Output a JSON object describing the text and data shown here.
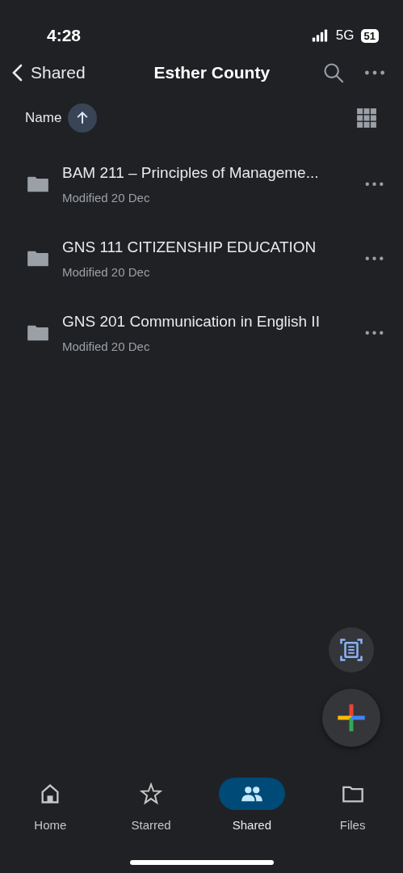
{
  "status_bar": {
    "time": "4:28",
    "network": "5G",
    "battery": "51"
  },
  "header": {
    "back_label": "Shared",
    "title": "Esther County"
  },
  "sort": {
    "label": "Name"
  },
  "files": [
    {
      "name": "BAM 211 – Principles of Manageme...",
      "modified": "Modified 20 Dec"
    },
    {
      "name": "GNS 111 CITIZENSHIP EDUCATION",
      "modified": "Modified 20 Dec"
    },
    {
      "name": "GNS 201 Communication in English II",
      "modified": "Modified 20 Dec"
    }
  ],
  "bottom_nav": [
    {
      "kind": "home",
      "label": "Home",
      "selected": false
    },
    {
      "kind": "star",
      "label": "Starred",
      "selected": false
    },
    {
      "kind": "people",
      "label": "Shared",
      "selected": true
    },
    {
      "kind": "folder",
      "label": "Files",
      "selected": false
    }
  ]
}
